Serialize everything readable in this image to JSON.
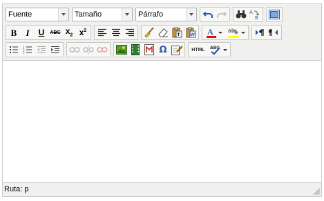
{
  "toolbar": {
    "font_select": "Fuente",
    "size_select": "Tamaño",
    "format_select": "Párrafo",
    "strike_label": "ABC",
    "html_label": "HTML",
    "spell_label": "ABC"
  },
  "colors": {
    "toolbar_bg": "#f0f0ee",
    "border": "#cccccc",
    "accent_blue": "#2b5ba8",
    "text_color_bar": "#ff0000",
    "highlight_bar": "#ffff00"
  },
  "statusbar": {
    "path_label": "Ruta: p"
  }
}
